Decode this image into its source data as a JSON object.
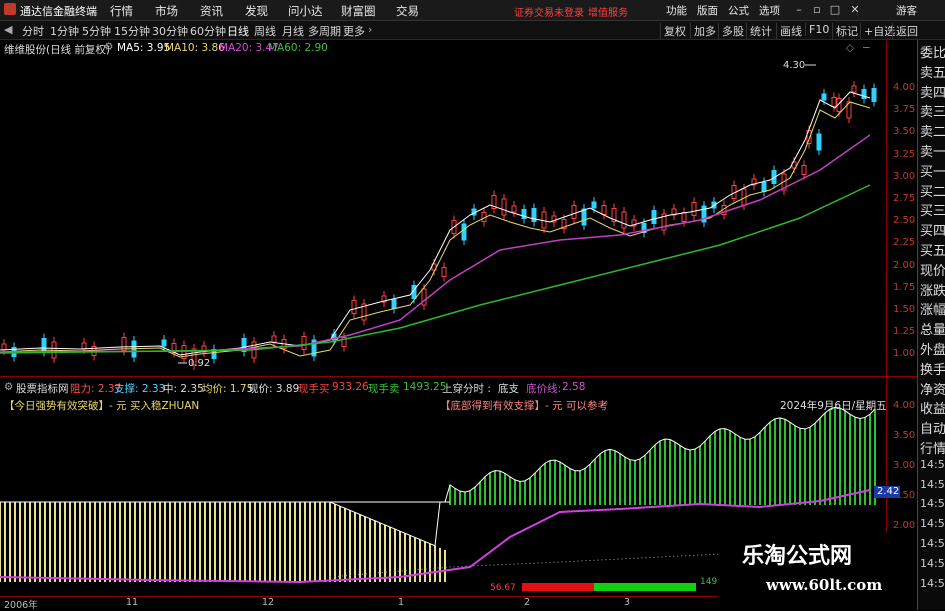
{
  "app": {
    "title": "通达信金融终端"
  },
  "menu": {
    "items": [
      "行情",
      "市场",
      "资讯",
      "发现",
      "问小达",
      "财富圈",
      "交易"
    ],
    "status": "证券交易未登录",
    "link": "增值服务",
    "right": [
      "功能",
      "版面",
      "公式",
      "选项"
    ],
    "guest": "游客"
  },
  "periods": [
    "分时",
    "1分钟",
    "5分钟",
    "15分钟",
    "30分钟",
    "60分钟",
    "日线",
    "周线",
    "月线",
    "多周期",
    "更多"
  ],
  "toolbar": [
    "复权",
    "加多",
    "多股",
    "统计",
    "画线",
    "F10",
    "标记",
    "+自选",
    "返回"
  ],
  "main": {
    "stock": "维维股份(日线 前复权)",
    "ma5_label": "MA5: 3.95",
    "ma10_label": "MA10: 3.86",
    "ma20_label": "MA20: 3.47",
    "ma60_label": "MA60: 2.90",
    "high_label": "4.30",
    "low_label": "0.92",
    "yticks": [
      "4.00",
      "3.75",
      "3.50",
      "3.25",
      "3.00",
      "2.75",
      "2.50",
      "2.25",
      "2.00",
      "1.75",
      "1.50",
      "1.25",
      "1.00"
    ]
  },
  "indicator": {
    "name": "股票指标网",
    "zuli": "阻力: 2.37",
    "zhicheng": "支撑: 2.33",
    "zhong": "中: 2.35",
    "junjia": "均价: 1.75",
    "xianjia": "现价: 3.89",
    "xianshoumai_label": "现手买",
    "xianshoumai": "933.26",
    "xianshoumai2_label": "现手卖",
    "xianshoumai2": "1493.25",
    "shangchuan": "上穿分时 :",
    "didi": "底支",
    "dijiaxian": "底价线:",
    "dijia": "2.58",
    "note1": "【今日强势有效突破】- 元 买入稳ZHUAN",
    "note2": "【底部得到有效支撑】- 元 可以参考",
    "date": "2024年9月6日/星期五",
    "current_value": "2.42",
    "yticks": [
      "4.00",
      "3.50",
      "3.00",
      "2.50",
      "2.00"
    ],
    "bottom_left": "56.67",
    "bottom_right": "149"
  },
  "right_panel": [
    "委比",
    "卖五",
    "卖四",
    "卖三",
    "卖二",
    "卖一",
    "买一",
    "买二",
    "买三",
    "买四",
    "买五",
    "现价",
    "涨跌",
    "涨幅",
    "总量",
    "外盘",
    "换手",
    "净资",
    "收益",
    "自动",
    "行情",
    "14:5",
    "14:5",
    "14:5",
    "14:5",
    "14:5",
    "14:5",
    "14:5"
  ],
  "xaxis": [
    "2006年",
    "11",
    "12",
    "1",
    "2",
    "3"
  ],
  "watermark": {
    "title": "乐淘公式网",
    "url": "www.60lt.com"
  }
}
